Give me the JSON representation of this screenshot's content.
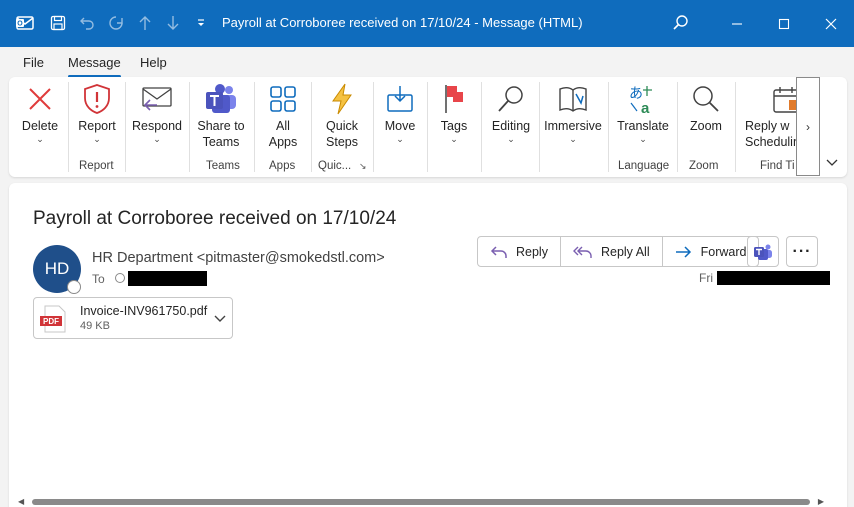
{
  "window": {
    "title": "Payroll at Corroboree received on 17/10/24  -  Message (HTML)"
  },
  "menu": {
    "items": [
      {
        "label": "File"
      },
      {
        "label": "Message"
      },
      {
        "label": "Help"
      }
    ]
  },
  "ribbon": {
    "delete": "Delete",
    "report": "Report",
    "respond": "Respond",
    "share_to_teams": "Share to\nTeams",
    "all_apps": "All\nApps",
    "quick_steps": "Quick\nSteps",
    "move": "Move",
    "tags": "Tags",
    "editing": "Editing",
    "immersive": "Immersive",
    "translate": "Translate",
    "zoom": "Zoom",
    "reply_scheduling": "Reply w\nScheduling",
    "groups": {
      "report": "Report",
      "teams": "Teams",
      "apps": "Apps",
      "quick": "Quic...",
      "language": "Language",
      "zoom": "Zoom",
      "find_time": "Find Ti"
    }
  },
  "message": {
    "subject": "Payroll at Corroboree received on 17/10/24",
    "avatar_initials": "HD",
    "sender": "HR Department <pitmaster@smokedstl.com>",
    "to_label": "To",
    "date_prefix": "Fri",
    "actions": {
      "reply": "Reply",
      "reply_all": "Reply All",
      "forward": "Forward"
    },
    "attachment": {
      "name": "Invoice-INV961750.pdf",
      "size": "49 KB",
      "type_label": "PDF"
    }
  },
  "colors": {
    "titlebar": "#0f6cbd",
    "accent": "#0f6cbd",
    "avatar": "#1f4f8a"
  }
}
